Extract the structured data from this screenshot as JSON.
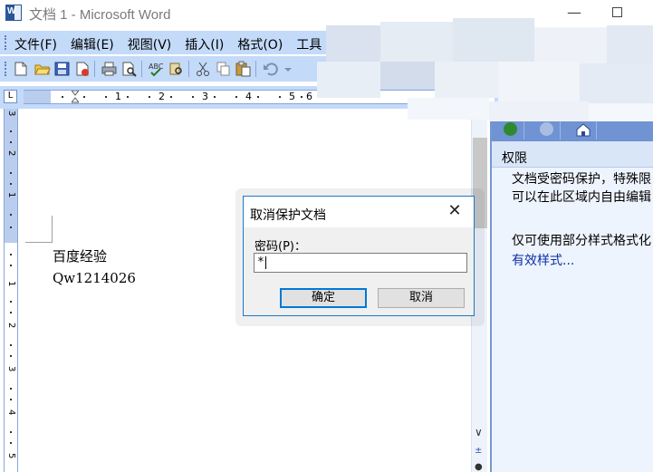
{
  "window": {
    "title": "文档 1 - Microsoft Word"
  },
  "menu": {
    "items": [
      {
        "label": "文件(F)"
      },
      {
        "label": "编辑(E)"
      },
      {
        "label": "视图(V)"
      },
      {
        "label": "插入(I)"
      },
      {
        "label": "格式(O)"
      },
      {
        "label": "工具"
      }
    ]
  },
  "ruler": {
    "corner": "L",
    "marks": [
      "1",
      "2",
      "3",
      "4",
      "5",
      "6"
    ],
    "vmarks": [
      "3",
      "2",
      "1",
      "1",
      "2",
      "3",
      "4",
      "5"
    ]
  },
  "document": {
    "lines": [
      "百度经验",
      "Qw1214026"
    ]
  },
  "task_pane": {
    "title": "权限",
    "lines": [
      "文档受密码保护，特殊限",
      "可以在此区域内自由编辑",
      "仅可使用部分样式格式化"
    ],
    "link": "有效样式..."
  },
  "dialog": {
    "title": "取消保护文档",
    "password_label": "密码(P)：",
    "password_value": "*",
    "ok_label": "确定",
    "cancel_label": "取消"
  },
  "colors": {
    "chrome": "#c3daf9",
    "dialog_border": "#1979ca",
    "primary_button_border": "#0078d7",
    "link": "#0b2ea8"
  }
}
